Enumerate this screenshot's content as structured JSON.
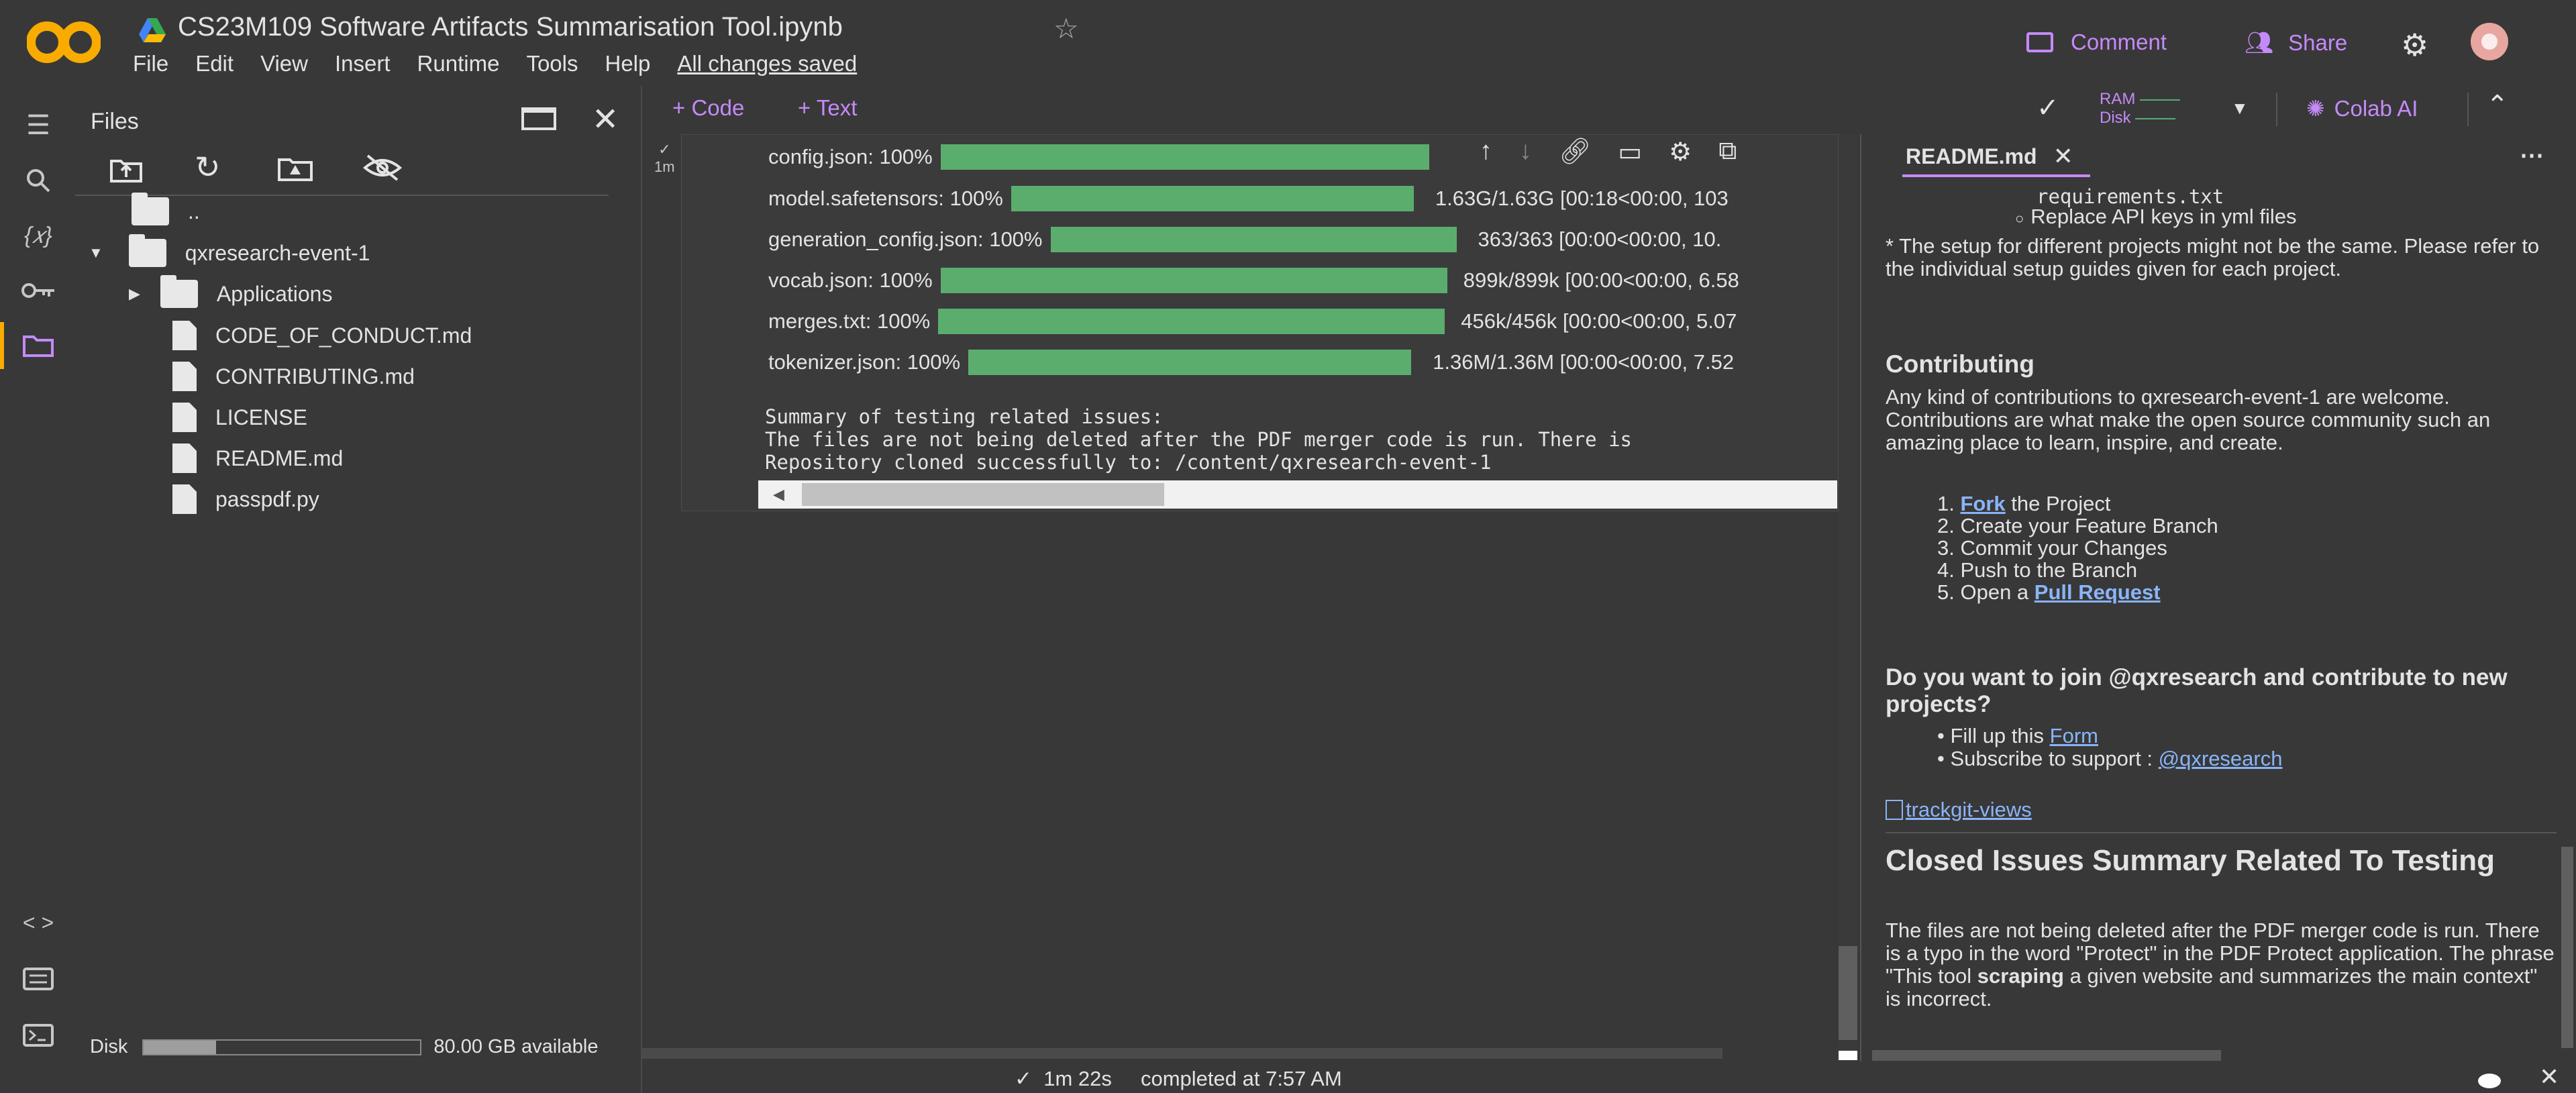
{
  "app": {
    "title": "CS23M109 Software Artifacts Summarisation Tool.ipynb",
    "logo_text": "CO",
    "menu": [
      "File",
      "Edit",
      "View",
      "Insert",
      "Runtime",
      "Tools",
      "Help"
    ],
    "saved_status": "All changes saved",
    "comment_label": "Comment",
    "share_label": "Share"
  },
  "toolbar": {
    "code_label": "+ Code",
    "text_label": "+ Text",
    "ram_label": "RAM",
    "disk_label": "Disk",
    "colab_ai_label": "Colab AI"
  },
  "files_panel": {
    "title": "Files",
    "items": [
      {
        "name": "..",
        "kind": "folder"
      },
      {
        "name": "qxresearch-event-1",
        "kind": "folder"
      },
      {
        "name": "Applications",
        "kind": "folder"
      },
      {
        "name": "CODE_OF_CONDUCT.md",
        "kind": "file"
      },
      {
        "name": "CONTRIBUTING.md",
        "kind": "file"
      },
      {
        "name": "LICENSE",
        "kind": "file"
      },
      {
        "name": "README.md",
        "kind": "file"
      },
      {
        "name": "passpdf.py",
        "kind": "file"
      }
    ],
    "disk_label": "Disk",
    "disk_available": "80.00 GB available",
    "disk_used_fraction": 0.26
  },
  "cell": {
    "exec_time": "1m",
    "progress": [
      {
        "file": "config.json:",
        "pct": "100%",
        "stats": ""
      },
      {
        "file": "model.safetensors:",
        "pct": "100%",
        "stats": "1.63G/1.63G  [00:18<00:00,  103"
      },
      {
        "file": "generation_config.json:",
        "pct": "100%",
        "stats": "363/363  [00:00<00:00,  10."
      },
      {
        "file": "vocab.json:",
        "pct": "100%",
        "stats": "899k/899k  [00:00<00:00,  6.58"
      },
      {
        "file": "merges.txt:",
        "pct": "100%",
        "stats": "456k/456k  [00:00<00:00,  5.07"
      },
      {
        "file": "tokenizer.json:",
        "pct": "100%",
        "stats": "1.36M/1.36M  [00:00<00:00,  7.52"
      }
    ],
    "output_lines": [
      "Summary of testing related issues:",
      "The files are not being deleted after the PDF merger code is run. There is",
      "Repository cloned successfully to: /content/qxresearch-event-1"
    ]
  },
  "readme": {
    "tab_label": "README.md",
    "req_line": "requirements.txt",
    "api_line": "Replace API keys in yml files",
    "setup_note": "* The setup for different projects might not be the same. Please refer to the individual setup guides given for each project.",
    "contrib_heading": "Contributing",
    "contrib_text": "Any kind of contributions to qxresearch-event-1 are welcome. Contributions are what make the open source community such an amazing place to learn, inspire, and create.",
    "steps": [
      {
        "num": "1.",
        "link": "Fork",
        "text": " the Project"
      },
      {
        "num": "2.",
        "link": "",
        "text": "Create your Feature Branch"
      },
      {
        "num": "3.",
        "link": "",
        "text": "Commit your Changes"
      },
      {
        "num": "4.",
        "link": "",
        "text": "Push to the Branch"
      },
      {
        "num": "5.",
        "link": "Pull Request",
        "text": "Open a "
      }
    ],
    "join_heading": "Do you want to join @qxresearch and contribute to new projects?",
    "fill_text": "Fill up this ",
    "fill_link": "Form",
    "subscribe_text": "Subscribe to support : ",
    "subscribe_link": "@qxresearch",
    "trackgit": "trackgit-views",
    "closed_heading": "Closed Issues Summary Related To Testing",
    "closed_text_1": "The files are not being deleted after the PDF merger code is run. There is a typo in the word \"Protect\" in the PDF Protect application. The phrase \"This tool ",
    "closed_bold": "scraping",
    "closed_text_2": " a given website and summarizes the main context\" is incorrect."
  },
  "status": {
    "check": "✓",
    "duration": "1m 22s",
    "completed": "completed at 7:57 AM"
  }
}
